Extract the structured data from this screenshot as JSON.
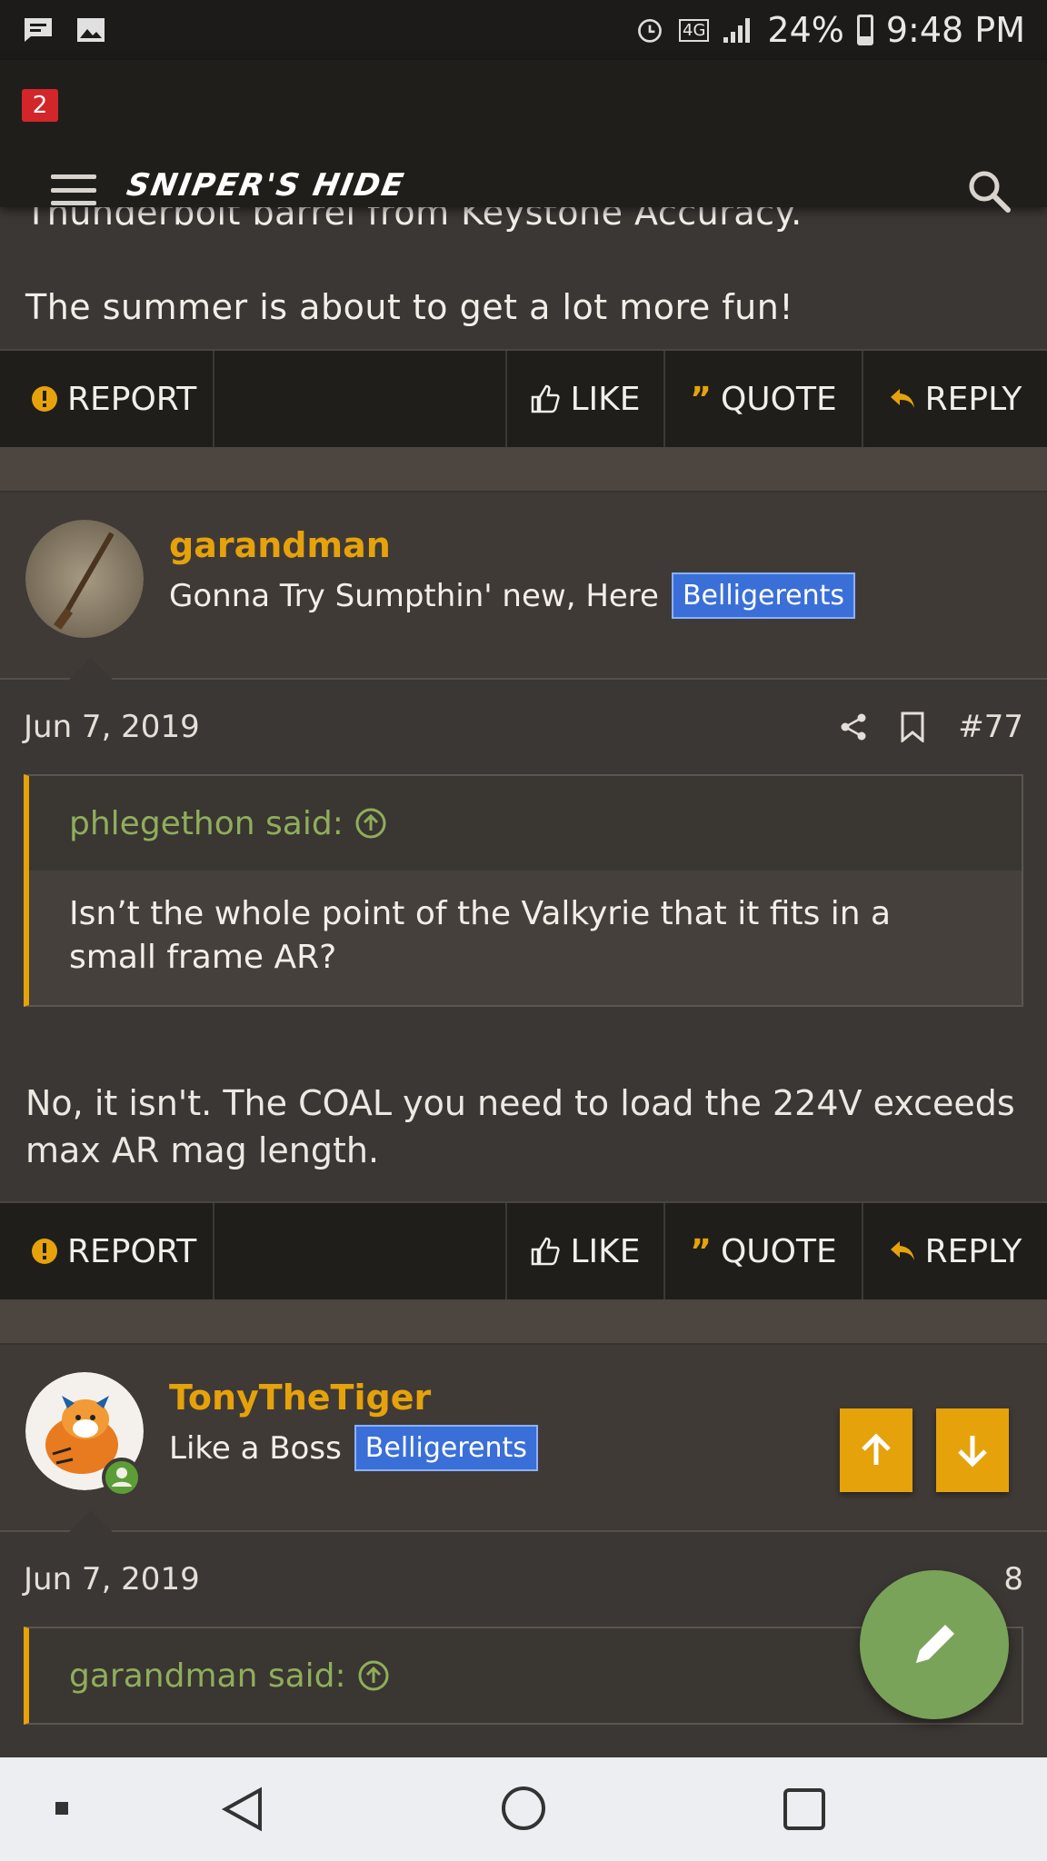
{
  "status_bar": {
    "battery": "24%",
    "time": "9:48 PM",
    "network": "4G"
  },
  "header": {
    "notification_count": "2",
    "logo_text": "SNIPER'S HIDE"
  },
  "post_top": {
    "text_line1": "Thunderbolt barrel from Keystone Accuracy.",
    "text_line2": "The summer is about to get a lot more fun!"
  },
  "actions": {
    "report": "REPORT",
    "like": "LIKE",
    "quote": "QUOTE",
    "reply": "REPLY"
  },
  "post77": {
    "username": "garandman",
    "user_title": "Gonna Try Sumpthin' new, Here",
    "badge": "Belligerents",
    "date": "Jun 7, 2019",
    "post_number": "#77",
    "quote_author": "phlegethon said:",
    "quote_text": "Isn’t the whole point of the Valkyrie that it fits in a small frame AR?",
    "body": "No, it isn't. The COAL you need to load the 224V exceeds max AR mag length."
  },
  "post78": {
    "username": "TonyTheTiger",
    "user_title": "Like a Boss",
    "badge": "Belligerents",
    "date": "Jun 7, 2019",
    "post_number": "8",
    "quote_author": "garandman said:"
  },
  "colors": {
    "accent": "#e5a20b",
    "quote_author": "#8fae5b",
    "badge": "#3a6fd8",
    "fab": "#7aa35a"
  }
}
